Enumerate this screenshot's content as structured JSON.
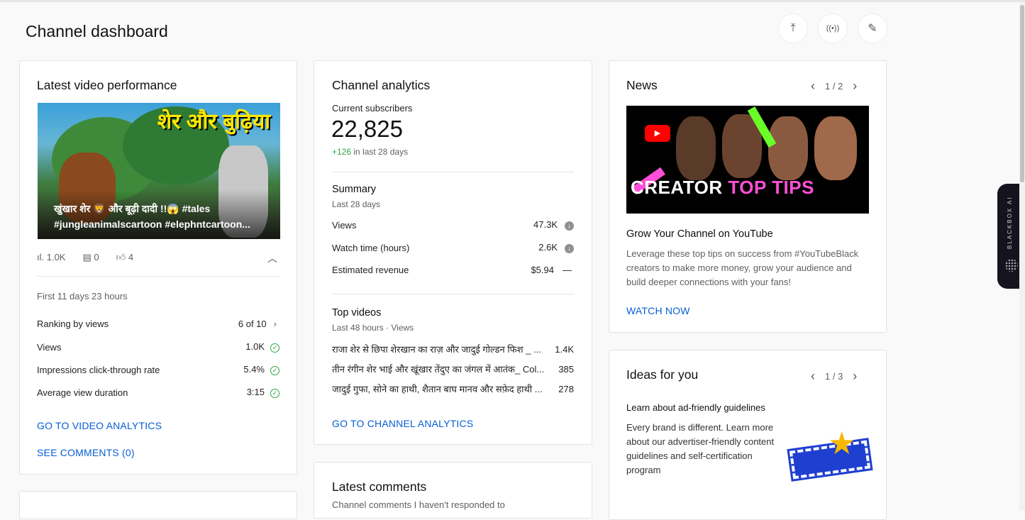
{
  "header": {
    "title": "Channel dashboard",
    "actions": [
      {
        "icon": "upload-icon",
        "glyph": "⤒"
      },
      {
        "icon": "live-icon",
        "glyph": "((•))"
      },
      {
        "icon": "edit-icon",
        "glyph": "✎"
      }
    ]
  },
  "latest_video": {
    "heading": "Latest video performance",
    "thumb_title_text": "शेर और बुढ़िया",
    "video_title_line1": "खुंखार शेर 🦁 और बूढ़ी दादी !!😱 #tales",
    "video_title_line2": "#jungleanimalscartoon #elephntcartoon...",
    "views": "1.0K",
    "comments": "0",
    "likes": "4",
    "period": "First 11 days 23 hours",
    "metrics": [
      {
        "label": "Ranking by views",
        "value": "6 of 10"
      },
      {
        "label": "Views",
        "value": "1.0K"
      },
      {
        "label": "Impressions click-through rate",
        "value": "5.4%"
      },
      {
        "label": "Average view duration",
        "value": "3:15"
      }
    ],
    "link1": "GO TO VIDEO ANALYTICS",
    "link2": "SEE COMMENTS (0)"
  },
  "analytics": {
    "heading": "Channel analytics",
    "subs_label": "Current subscribers",
    "subs": "22,825",
    "subs_change": "+126",
    "subs_change_suffix": "in last 28 days",
    "summary_title": "Summary",
    "summary_period": "Last 28 days",
    "summary": [
      {
        "label": "Views",
        "value": "47.3K",
        "icon": "down-arrow-icon"
      },
      {
        "label": "Watch time (hours)",
        "value": "2.6K",
        "icon": "down-arrow-icon"
      },
      {
        "label": "Estimated revenue",
        "value": "$5.94",
        "icon": "dash-icon"
      }
    ],
    "top_title": "Top videos",
    "top_period": "Last 48 hours · Views",
    "top_videos": [
      {
        "title": "राजा शेर से छिपा शेरखान का राज़ और जादुई गोल्डन फिश _ ...",
        "views": "1.4K"
      },
      {
        "title": "तीन रंगीन शेर भाई और खूंखार तेंदुए का जंगल में आतंक_ Col...",
        "views": "385"
      },
      {
        "title": "जादुई गुफा, सोने का हाथी, शैतान बाघ मानव और सफ़ेद हाथी ...",
        "views": "278"
      }
    ],
    "link": "GO TO CHANNEL ANALYTICS"
  },
  "comments": {
    "heading": "Latest comments",
    "sub": "Channel comments I haven't responded to"
  },
  "news": {
    "heading": "News",
    "pager": "1 / 2",
    "banner_text1": "CREATOR",
    "banner_text2": "TOP TIPS",
    "title": "Grow Your Channel on YouTube",
    "body": "Leverage these top tips on success from #YouTubeBlack creators to make more money, grow your audience and build deeper connections with your fans!",
    "link": "WATCH NOW"
  },
  "ideas": {
    "heading": "Ideas for you",
    "pager": "1 / 3",
    "title": "Learn about ad-friendly guidelines",
    "body": "Every brand is different. Learn more about our advertiser-friendly content guidelines and self-certification program"
  },
  "blackbox": {
    "label": "BLACKBOX AI"
  },
  "colors": {
    "link": "#065fd4",
    "positive": "#2ba640",
    "accent_pink": "#ff4fd8"
  }
}
